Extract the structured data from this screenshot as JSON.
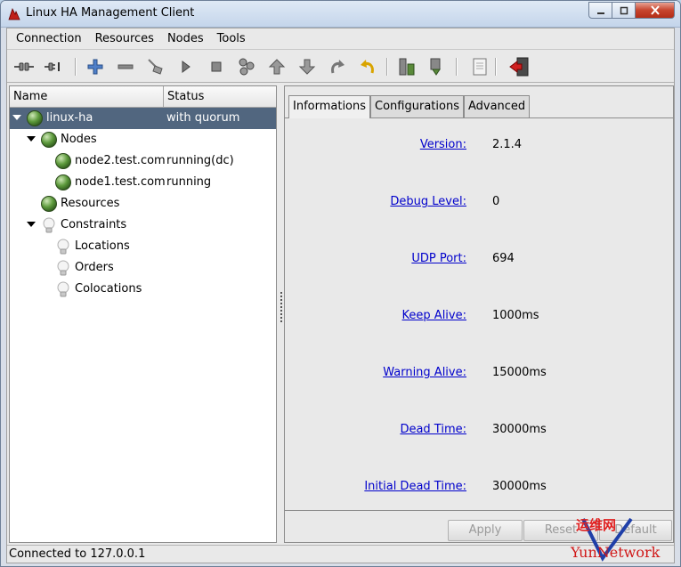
{
  "window": {
    "title": "Linux HA Management Client"
  },
  "menubar": {
    "items": [
      "Connection",
      "Resources",
      "Nodes",
      "Tools"
    ]
  },
  "toolbar": {
    "buttons": [
      "connect-icon",
      "disconnect-icon",
      "add-icon",
      "remove-icon",
      "cleanup-icon",
      "start-icon",
      "stop-icon",
      "migrate-icon",
      "move-up-icon",
      "move-down-icon",
      "redo-icon",
      "undo-icon",
      "standby-icon",
      "active-icon",
      "log-icon",
      "exit-icon"
    ]
  },
  "tree": {
    "columns": [
      "Name",
      "Status"
    ],
    "rows": [
      {
        "name": "linux-ha",
        "status": "with quorum"
      },
      {
        "name": "Nodes",
        "status": ""
      },
      {
        "name": "node2.test.com",
        "status": "running(dc)"
      },
      {
        "name": "node1.test.com",
        "status": "running"
      },
      {
        "name": "Resources",
        "status": ""
      },
      {
        "name": "Constraints",
        "status": ""
      },
      {
        "name": "Locations",
        "status": ""
      },
      {
        "name": "Orders",
        "status": ""
      },
      {
        "name": "Colocations",
        "status": ""
      }
    ]
  },
  "tabs": [
    "Informations",
    "Configurations",
    "Advanced"
  ],
  "info": [
    {
      "label": "Version:",
      "value": "2.1.4"
    },
    {
      "label": "Debug Level:",
      "value": "0"
    },
    {
      "label": "UDP Port:",
      "value": "694"
    },
    {
      "label": "Keep Alive:",
      "value": "1000ms"
    },
    {
      "label": "Warning Alive:",
      "value": "15000ms"
    },
    {
      "label": "Dead Time:",
      "value": "30000ms"
    },
    {
      "label": "Initial Dead Time:",
      "value": "30000ms"
    }
  ],
  "buttons": {
    "apply": "Apply",
    "reset": "Reset",
    "default": "Default"
  },
  "status": {
    "text": "Connected to 127.0.0.1"
  },
  "watermark": {
    "cn": "运维网",
    "en": "YunNetwork"
  }
}
